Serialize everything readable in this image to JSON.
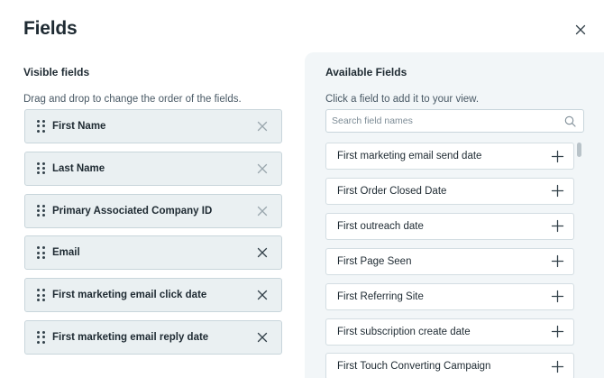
{
  "modal": {
    "title": "Fields"
  },
  "visible": {
    "title": "Visible fields",
    "description": "Drag and drop to change the order of the fields.",
    "items": [
      {
        "label": "First Name",
        "remove_muted": true
      },
      {
        "label": "Last Name",
        "remove_muted": true
      },
      {
        "label": "Primary Associated Company ID",
        "remove_muted": true
      },
      {
        "label": "Email",
        "remove_muted": false
      },
      {
        "label": "First marketing email click date",
        "remove_muted": false
      },
      {
        "label": "First marketing email reply date",
        "remove_muted": false
      }
    ]
  },
  "available": {
    "title": "Available Fields",
    "description": "Click a field to add it to your view.",
    "search_placeholder": "Search field names",
    "search_value": "",
    "items": [
      {
        "label": "First marketing email send date"
      },
      {
        "label": "First Order Closed Date"
      },
      {
        "label": "First outreach date"
      },
      {
        "label": "First Page Seen"
      },
      {
        "label": "First Referring Site"
      },
      {
        "label": "First subscription create date"
      },
      {
        "label": "First Touch Converting Campaign"
      }
    ]
  },
  "colors": {
    "field_bg": "#eaf0f2",
    "panel_bg": "#f2f6f8",
    "text": "#1e2a32",
    "muted_icon": "#9aa7ae"
  },
  "icons": {
    "close": "close-icon",
    "drag": "drag-handle-icon",
    "remove": "remove-icon",
    "search": "search-icon",
    "add": "plus-icon"
  }
}
